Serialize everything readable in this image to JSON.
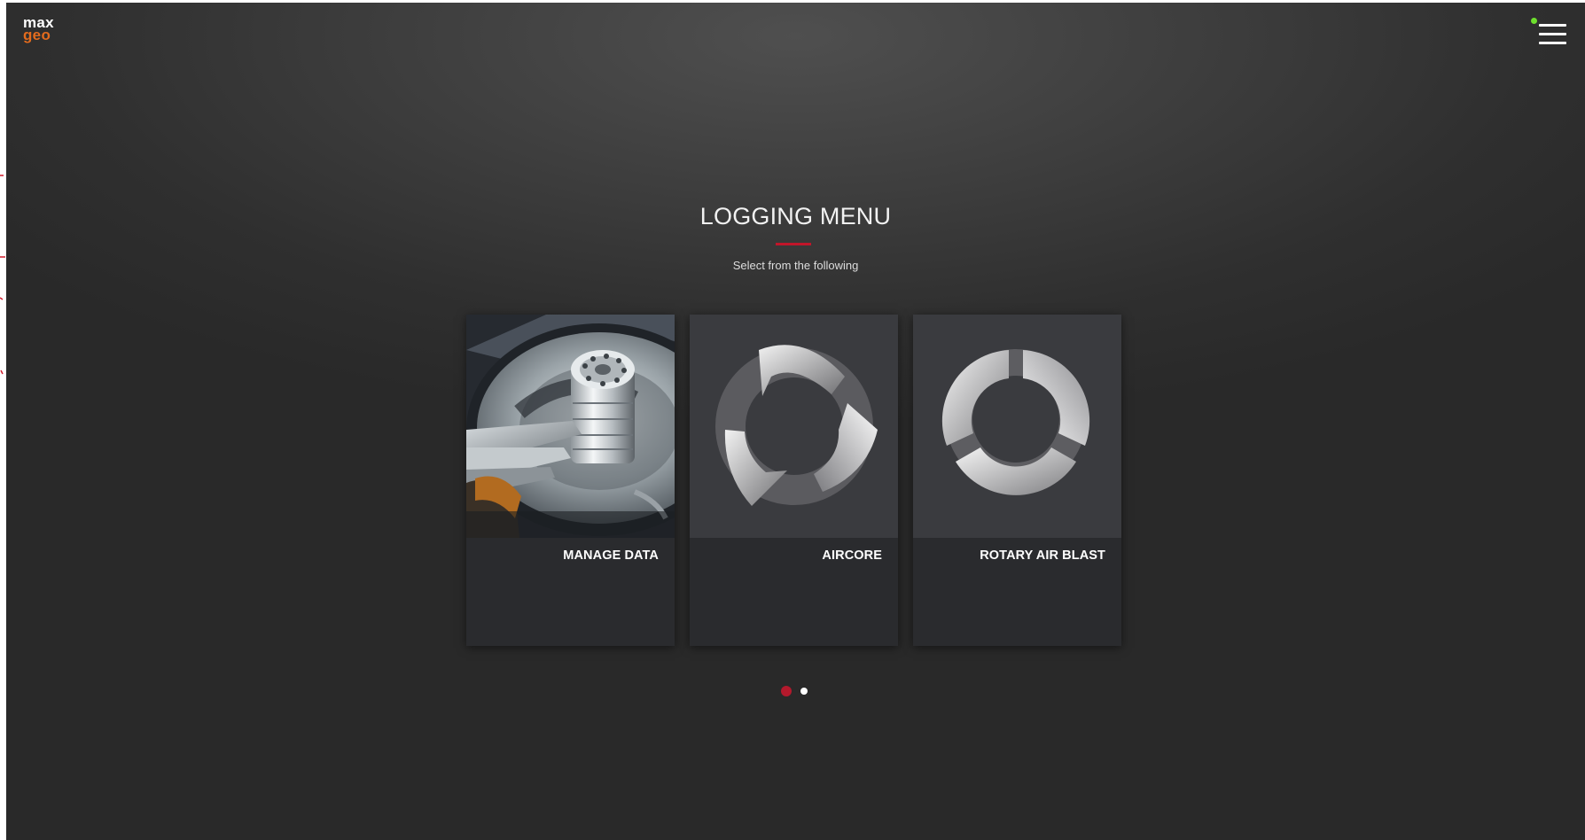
{
  "brand": {
    "logo_line1": "max",
    "logo_line2": "geo",
    "accent": "#e36b1d"
  },
  "header": {
    "menu_icon": "hamburger-icon",
    "status_color": "#6ee02d"
  },
  "page": {
    "title": "LOGGING MENU",
    "subtitle": "Select from the following",
    "accent_color": "#c0162a"
  },
  "cards": [
    {
      "label": "MANAGE DATA",
      "icon": "hard-drive-image"
    },
    {
      "label": "AIRCORE",
      "icon": "aircore-swirl-icon"
    },
    {
      "label": "ROTARY AIR BLAST",
      "icon": "rotary-air-blast-icon"
    }
  ],
  "pagination": {
    "current": 1,
    "total": 2
  }
}
